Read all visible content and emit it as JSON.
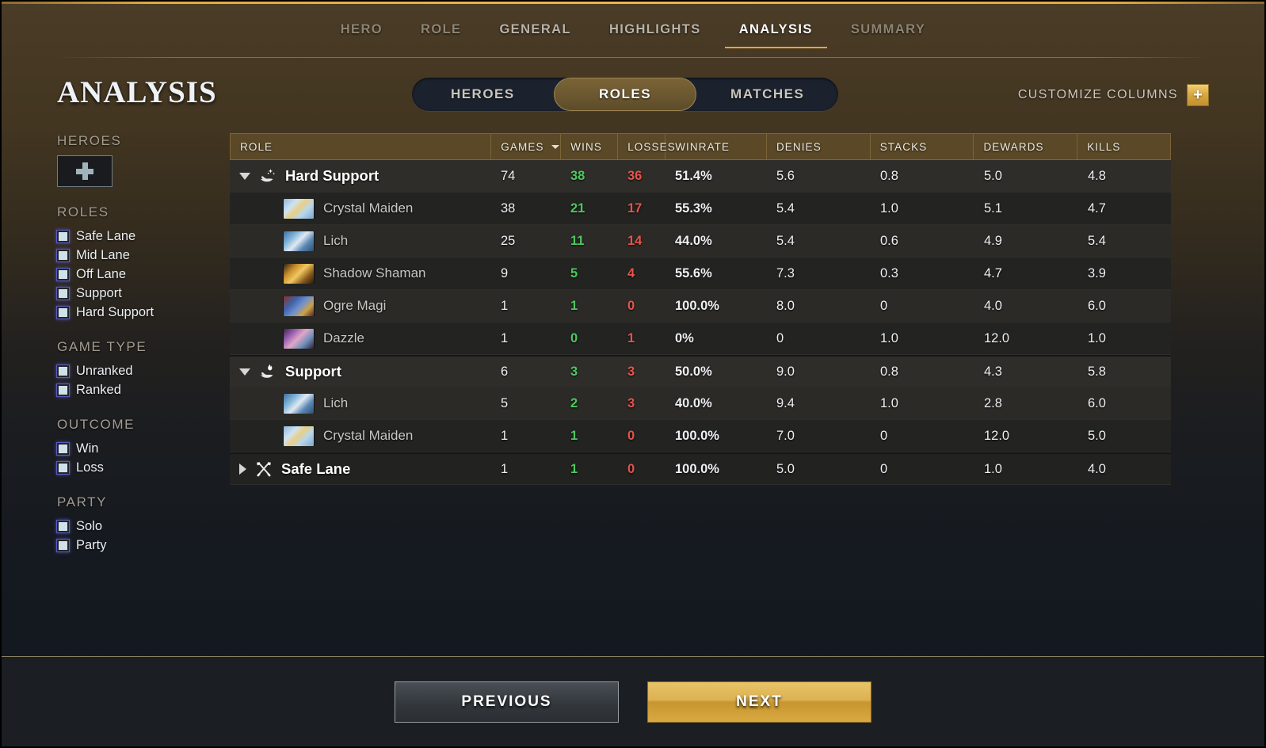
{
  "nav": {
    "items": [
      {
        "label": "HERO",
        "state": "dim"
      },
      {
        "label": "ROLE",
        "state": "dim"
      },
      {
        "label": "GENERAL",
        "state": "normal"
      },
      {
        "label": "HIGHLIGHTS",
        "state": "normal"
      },
      {
        "label": "ANALYSIS",
        "state": "active"
      },
      {
        "label": "SUMMARY",
        "state": "dim"
      }
    ]
  },
  "page": {
    "title": "ANALYSIS",
    "accent_gold": "#e8a33c",
    "win_color": "#4cc95f",
    "loss_color": "#e2554b"
  },
  "segmented": {
    "options": [
      {
        "label": "HEROES",
        "active": false
      },
      {
        "label": "ROLES",
        "active": true
      },
      {
        "label": "MATCHES",
        "active": false
      }
    ]
  },
  "customize_columns": {
    "label": "CUSTOMIZE COLUMNS",
    "button_glyph": "+",
    "icon": "plus-icon"
  },
  "sidebar": {
    "heroes": {
      "heading": "HEROES",
      "add_icon": "plus-icon"
    },
    "groups": [
      {
        "heading": "ROLES",
        "items": [
          {
            "label": "Safe Lane",
            "checked": false
          },
          {
            "label": "Mid Lane",
            "checked": false
          },
          {
            "label": "Off Lane",
            "checked": false
          },
          {
            "label": "Support",
            "checked": false
          },
          {
            "label": "Hard Support",
            "checked": false
          }
        ]
      },
      {
        "heading": "GAME TYPE",
        "items": [
          {
            "label": "Unranked",
            "checked": false
          },
          {
            "label": "Ranked",
            "checked": false
          }
        ]
      },
      {
        "heading": "OUTCOME",
        "items": [
          {
            "label": "Win",
            "checked": false
          },
          {
            "label": "Loss",
            "checked": false
          }
        ]
      },
      {
        "heading": "PARTY",
        "items": [
          {
            "label": "Solo",
            "checked": false
          },
          {
            "label": "Party",
            "checked": false
          }
        ]
      }
    ]
  },
  "table": {
    "columns": [
      {
        "key": "role",
        "label": "ROLE",
        "sorted": false
      },
      {
        "key": "games",
        "label": "GAMES",
        "sorted": true,
        "sort_icon": "chevron-down-icon"
      },
      {
        "key": "wins",
        "label": "WINS",
        "sorted": false
      },
      {
        "key": "losses",
        "label": "LOSSES",
        "sorted": false
      },
      {
        "key": "winrate",
        "label": "WINRATE",
        "sorted": false
      },
      {
        "key": "denies",
        "label": "DENIES",
        "sorted": false
      },
      {
        "key": "stacks",
        "label": "STACKS",
        "sorted": false
      },
      {
        "key": "dewards",
        "label": "DEWARDS",
        "sorted": false
      },
      {
        "key": "kills",
        "label": "KILLS",
        "sorted": false
      }
    ],
    "rows": [
      {
        "type": "group",
        "expanded": true,
        "icon": "hand-sparkle-icon",
        "role": "Hard Support",
        "games": "74",
        "wins": "38",
        "losses": "36",
        "winrate": "51.4%",
        "denies": "5.6",
        "stacks": "0.8",
        "dewards": "5.0",
        "kills": "4.8"
      },
      {
        "type": "hero",
        "portrait": "crystal-maiden-portrait",
        "role": "Crystal Maiden",
        "games": "38",
        "wins": "21",
        "losses": "17",
        "winrate": "55.3%",
        "denies": "5.4",
        "stacks": "1.0",
        "dewards": "5.1",
        "kills": "4.7"
      },
      {
        "type": "hero",
        "portrait": "lich-portrait",
        "role": "Lich",
        "games": "25",
        "wins": "11",
        "losses": "14",
        "winrate": "44.0%",
        "denies": "5.4",
        "stacks": "0.6",
        "dewards": "4.9",
        "kills": "5.4"
      },
      {
        "type": "hero",
        "portrait": "shadow-shaman-portrait",
        "role": "Shadow Shaman",
        "games": "9",
        "wins": "5",
        "losses": "4",
        "winrate": "55.6%",
        "denies": "7.3",
        "stacks": "0.3",
        "dewards": "4.7",
        "kills": "3.9"
      },
      {
        "type": "hero",
        "portrait": "ogre-magi-portrait",
        "role": "Ogre Magi",
        "games": "1",
        "wins": "1",
        "losses": "0",
        "winrate": "100.0%",
        "denies": "8.0",
        "stacks": "0",
        "dewards": "4.0",
        "kills": "6.0"
      },
      {
        "type": "hero",
        "portrait": "dazzle-portrait",
        "role": "Dazzle",
        "games": "1",
        "wins": "0",
        "losses": "1",
        "winrate": "0%",
        "denies": "0",
        "stacks": "1.0",
        "dewards": "12.0",
        "kills": "1.0"
      },
      {
        "type": "group",
        "expanded": true,
        "icon": "hand-flame-icon",
        "role": "Support",
        "games": "6",
        "wins": "3",
        "losses": "3",
        "winrate": "50.0%",
        "denies": "9.0",
        "stacks": "0.8",
        "dewards": "4.3",
        "kills": "5.8"
      },
      {
        "type": "hero",
        "portrait": "lich-portrait",
        "role": "Lich",
        "games": "5",
        "wins": "2",
        "losses": "3",
        "winrate": "40.0%",
        "denies": "9.4",
        "stacks": "1.0",
        "dewards": "2.8",
        "kills": "6.0"
      },
      {
        "type": "hero",
        "portrait": "crystal-maiden-portrait",
        "role": "Crystal Maiden",
        "games": "1",
        "wins": "1",
        "losses": "0",
        "winrate": "100.0%",
        "denies": "7.0",
        "stacks": "0",
        "dewards": "12.0",
        "kills": "5.0"
      },
      {
        "type": "group",
        "expanded": false,
        "icon": "crossed-swords-icon",
        "role": "Safe Lane",
        "games": "1",
        "wins": "1",
        "losses": "0",
        "winrate": "100.0%",
        "denies": "5.0",
        "stacks": "0",
        "dewards": "1.0",
        "kills": "4.0"
      }
    ]
  },
  "footer": {
    "previous_label": "PREVIOUS",
    "next_label": "NEXT"
  }
}
